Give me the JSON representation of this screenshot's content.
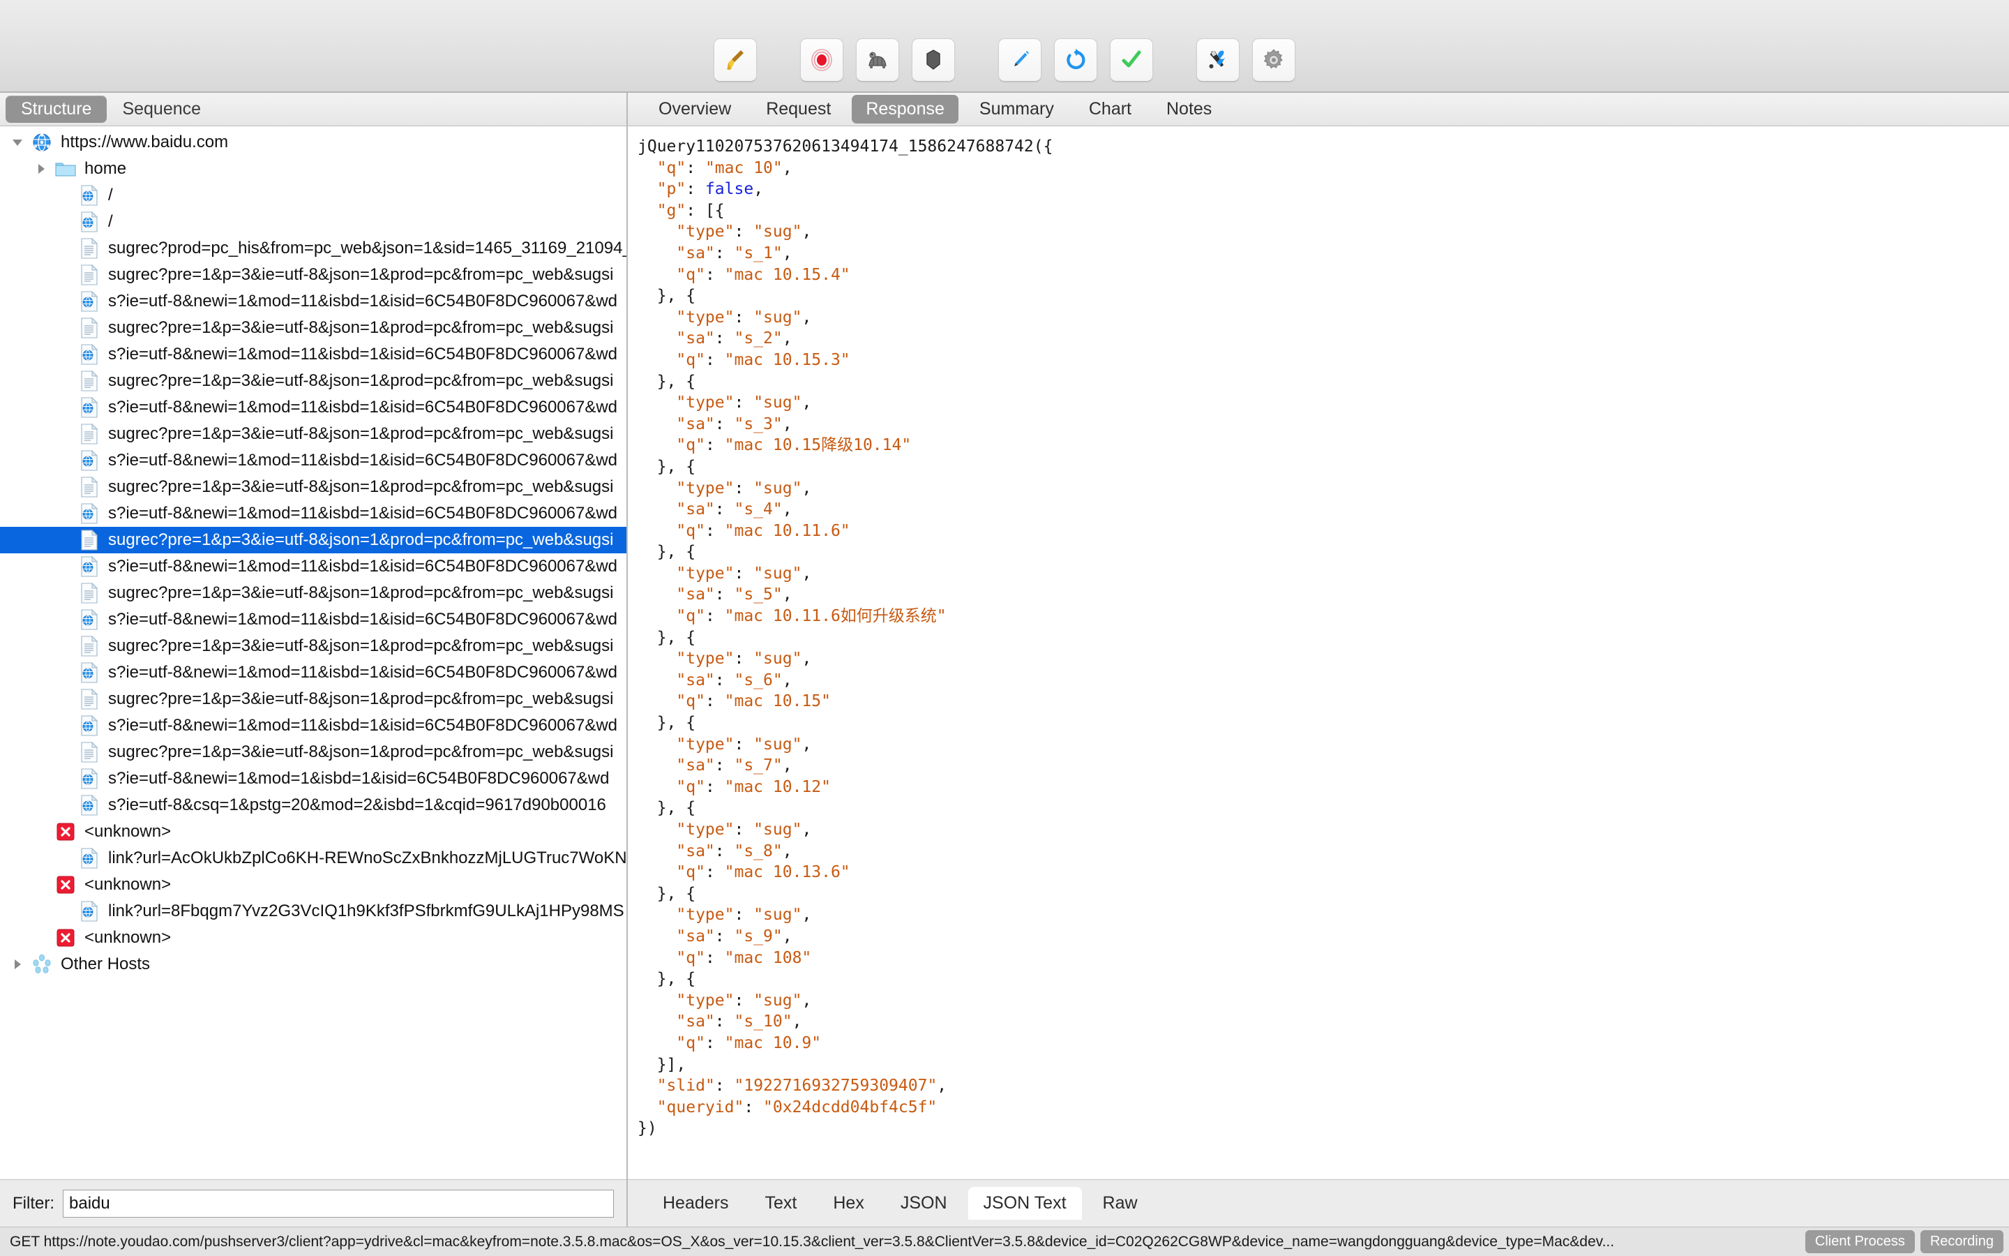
{
  "toolbar": {
    "groups": [
      [
        {
          "name": "clear-broom-icon",
          "label": "Clear"
        }
      ],
      [
        {
          "name": "record-icon",
          "label": "Start Recording"
        },
        {
          "name": "throttle-turtle-icon",
          "label": "Start Throttling"
        },
        {
          "name": "breakpoints-icon",
          "label": "Enable Breakpoints"
        }
      ],
      [
        {
          "name": "compose-pen-icon",
          "label": "Compose"
        },
        {
          "name": "repeat-refresh-icon",
          "label": "Repeat"
        },
        {
          "name": "validate-check-icon",
          "label": "Validate"
        }
      ],
      [
        {
          "name": "tools-icon",
          "label": "Tools"
        },
        {
          "name": "settings-gear-icon",
          "label": "Settings"
        }
      ]
    ]
  },
  "left": {
    "tabs": [
      {
        "label": "Structure",
        "active": true
      },
      {
        "label": "Sequence",
        "active": false
      }
    ],
    "tree": [
      {
        "label": "https://www.baidu.com",
        "icon": "host-globe-icon",
        "indent": 0,
        "disc": "down",
        "selected": false
      },
      {
        "label": "home",
        "icon": "folder-icon",
        "indent": 1,
        "disc": "right",
        "selected": false
      },
      {
        "label": "/",
        "icon": "page-web-icon",
        "indent": 2,
        "disc": "none",
        "selected": false
      },
      {
        "label": "/",
        "icon": "page-web-icon",
        "indent": 2,
        "disc": "none",
        "selected": false
      },
      {
        "label": "sugrec?prod=pc_his&from=pc_web&json=1&sid=1465_31169_21094_",
        "icon": "page-doc-icon",
        "indent": 2,
        "disc": "none",
        "selected": false
      },
      {
        "label": "sugrec?pre=1&p=3&ie=utf-8&json=1&prod=pc&from=pc_web&sugsi",
        "icon": "page-doc-icon",
        "indent": 2,
        "disc": "none",
        "selected": false
      },
      {
        "label": "s?ie=utf-8&newi=1&mod=11&isbd=1&isid=6C54B0F8DC960067&wd",
        "icon": "page-web-icon",
        "indent": 2,
        "disc": "none",
        "selected": false
      },
      {
        "label": "sugrec?pre=1&p=3&ie=utf-8&json=1&prod=pc&from=pc_web&sugsi",
        "icon": "page-doc-icon",
        "indent": 2,
        "disc": "none",
        "selected": false
      },
      {
        "label": "s?ie=utf-8&newi=1&mod=11&isbd=1&isid=6C54B0F8DC960067&wd",
        "icon": "page-web-icon",
        "indent": 2,
        "disc": "none",
        "selected": false
      },
      {
        "label": "sugrec?pre=1&p=3&ie=utf-8&json=1&prod=pc&from=pc_web&sugsi",
        "icon": "page-doc-icon",
        "indent": 2,
        "disc": "none",
        "selected": false
      },
      {
        "label": "s?ie=utf-8&newi=1&mod=11&isbd=1&isid=6C54B0F8DC960067&wd",
        "icon": "page-web-icon",
        "indent": 2,
        "disc": "none",
        "selected": false
      },
      {
        "label": "sugrec?pre=1&p=3&ie=utf-8&json=1&prod=pc&from=pc_web&sugsi",
        "icon": "page-doc-icon",
        "indent": 2,
        "disc": "none",
        "selected": false
      },
      {
        "label": "s?ie=utf-8&newi=1&mod=11&isbd=1&isid=6C54B0F8DC960067&wd",
        "icon": "page-web-icon",
        "indent": 2,
        "disc": "none",
        "selected": false
      },
      {
        "label": "sugrec?pre=1&p=3&ie=utf-8&json=1&prod=pc&from=pc_web&sugsi",
        "icon": "page-doc-icon",
        "indent": 2,
        "disc": "none",
        "selected": false
      },
      {
        "label": "s?ie=utf-8&newi=1&mod=11&isbd=1&isid=6C54B0F8DC960067&wd",
        "icon": "page-web-icon",
        "indent": 2,
        "disc": "none",
        "selected": false
      },
      {
        "label": "sugrec?pre=1&p=3&ie=utf-8&json=1&prod=pc&from=pc_web&sugsi",
        "icon": "page-doc-icon",
        "indent": 2,
        "disc": "none",
        "selected": true
      },
      {
        "label": "s?ie=utf-8&newi=1&mod=11&isbd=1&isid=6C54B0F8DC960067&wd",
        "icon": "page-web-icon",
        "indent": 2,
        "disc": "none",
        "selected": false
      },
      {
        "label": "sugrec?pre=1&p=3&ie=utf-8&json=1&prod=pc&from=pc_web&sugsi",
        "icon": "page-doc-icon",
        "indent": 2,
        "disc": "none",
        "selected": false
      },
      {
        "label": "s?ie=utf-8&newi=1&mod=11&isbd=1&isid=6C54B0F8DC960067&wd",
        "icon": "page-web-icon",
        "indent": 2,
        "disc": "none",
        "selected": false
      },
      {
        "label": "sugrec?pre=1&p=3&ie=utf-8&json=1&prod=pc&from=pc_web&sugsi",
        "icon": "page-doc-icon",
        "indent": 2,
        "disc": "none",
        "selected": false
      },
      {
        "label": "s?ie=utf-8&newi=1&mod=11&isbd=1&isid=6C54B0F8DC960067&wd",
        "icon": "page-web-icon",
        "indent": 2,
        "disc": "none",
        "selected": false
      },
      {
        "label": "sugrec?pre=1&p=3&ie=utf-8&json=1&prod=pc&from=pc_web&sugsi",
        "icon": "page-doc-icon",
        "indent": 2,
        "disc": "none",
        "selected": false
      },
      {
        "label": "s?ie=utf-8&newi=1&mod=11&isbd=1&isid=6C54B0F8DC960067&wd",
        "icon": "page-web-icon",
        "indent": 2,
        "disc": "none",
        "selected": false
      },
      {
        "label": "sugrec?pre=1&p=3&ie=utf-8&json=1&prod=pc&from=pc_web&sugsi",
        "icon": "page-doc-icon",
        "indent": 2,
        "disc": "none",
        "selected": false
      },
      {
        "label": "s?ie=utf-8&newi=1&mod=1&isbd=1&isid=6C54B0F8DC960067&wd",
        "icon": "page-web-icon",
        "indent": 2,
        "disc": "none",
        "selected": false
      },
      {
        "label": "s?ie=utf-8&csq=1&pstg=20&mod=2&isbd=1&cqid=9617d90b00016",
        "icon": "page-web-icon",
        "indent": 2,
        "disc": "none",
        "selected": false
      },
      {
        "label": "<unknown>",
        "icon": "error-x-icon",
        "indent": 1,
        "disc": "none",
        "selected": false
      },
      {
        "label": "link?url=AcOkUkbZplCo6KH-REWnoScZxBnkhozzMjLUGTruc7WoKN",
        "icon": "page-web-icon",
        "indent": 2,
        "disc": "none",
        "selected": false
      },
      {
        "label": "<unknown>",
        "icon": "error-x-icon",
        "indent": 1,
        "disc": "none",
        "selected": false
      },
      {
        "label": "link?url=8Fbqgm7Yvz2G3VcIQ1h9Kkf3fPSfbrkmfG9ULkAj1HPy98MS",
        "icon": "page-web-icon",
        "indent": 2,
        "disc": "none",
        "selected": false
      },
      {
        "label": "<unknown>",
        "icon": "error-x-icon",
        "indent": 1,
        "disc": "none",
        "selected": false
      },
      {
        "label": "Other Hosts",
        "icon": "other-hosts-icon",
        "indent": 0,
        "disc": "right",
        "selected": false
      }
    ],
    "filter": {
      "label": "Filter:",
      "value": "baidu",
      "placeholder": ""
    }
  },
  "right": {
    "tabs": [
      {
        "label": "Overview",
        "active": false
      },
      {
        "label": "Request",
        "active": false
      },
      {
        "label": "Response",
        "active": true
      },
      {
        "label": "Summary",
        "active": false
      },
      {
        "label": "Chart",
        "active": false
      },
      {
        "label": "Notes",
        "active": false
      }
    ],
    "bottom_tabs": [
      {
        "label": "Headers",
        "active": false
      },
      {
        "label": "Text",
        "active": false
      },
      {
        "label": "Hex",
        "active": false
      },
      {
        "label": "JSON",
        "active": false
      },
      {
        "label": "JSON Text",
        "active": true
      },
      {
        "label": "Raw",
        "active": false
      }
    ],
    "response_json": {
      "callback": "jQuery110207537620613494174_1586247688742({",
      "closer": "})",
      "q": "mac 10",
      "p": "false",
      "slid": "1922716932759309407",
      "queryid": "0x24dcdd04bf4c5f",
      "g": [
        {
          "type": "sug",
          "sa": "s_1",
          "q": "mac 10.15.4"
        },
        {
          "type": "sug",
          "sa": "s_2",
          "q": "mac 10.15.3"
        },
        {
          "type": "sug",
          "sa": "s_3",
          "q": "mac 10.15降级10.14"
        },
        {
          "type": "sug",
          "sa": "s_4",
          "q": "mac 10.11.6"
        },
        {
          "type": "sug",
          "sa": "s_5",
          "q": "mac 10.11.6如何升级系统"
        },
        {
          "type": "sug",
          "sa": "s_6",
          "q": "mac 10.15"
        },
        {
          "type": "sug",
          "sa": "s_7",
          "q": "mac 10.12"
        },
        {
          "type": "sug",
          "sa": "s_8",
          "q": "mac 10.13.6"
        },
        {
          "type": "sug",
          "sa": "s_9",
          "q": "mac 108"
        },
        {
          "type": "sug",
          "sa": "s_10",
          "q": "mac 10.9"
        }
      ]
    }
  },
  "statusbar": {
    "text": "GET https://note.youdao.com/pushserver3/client?app=ydrive&cl=mac&keyfrom=note.3.5.8.mac&os=OS_X&os_ver=10.15.3&client_ver=3.5.8&ClientVer=3.5.8&device_id=C02Q262CG8WP&device_name=wangdongguang&device_type=Mac&dev...",
    "chips": [
      "Client Process",
      "Recording"
    ]
  },
  "colors": {
    "selection": "#0a66de",
    "json_string": "#c85a11",
    "json_bool": "#1a22d8",
    "tab_active_bg": "#939393",
    "error_red": "#e8192c"
  }
}
